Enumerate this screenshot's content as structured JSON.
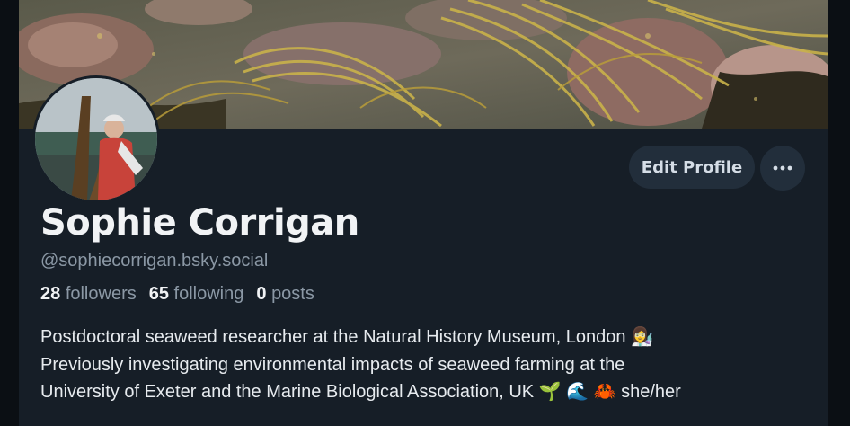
{
  "profile": {
    "display_name": "Sophie Corrigan",
    "handle": "@sophiecorrigan.bsky.social",
    "stats": {
      "followers_count": "28",
      "followers_label": "followers",
      "following_count": "65",
      "following_label": "following",
      "posts_count": "0",
      "posts_label": "posts"
    },
    "bio_lines": [
      "Postdoctoral seaweed researcher at the Natural History Museum, London 👩‍🔬",
      "Previously investigating environmental impacts of seaweed farming at the",
      "University of Exeter and the Marine Biological Association, UK 🌱 🌊 🦀 she/her"
    ]
  },
  "actions": {
    "edit_profile_label": "Edit Profile",
    "more_icon": "more-horizontal-icon"
  },
  "images": {
    "banner": "seaweed-rockpool-banner",
    "avatar": "person-holding-kelp-avatar"
  },
  "colors": {
    "background": "#0b0f14",
    "card": "#161e27",
    "button": "#222e3b",
    "muted_text": "#8b98a5",
    "primary_text": "#f1f3f5"
  }
}
